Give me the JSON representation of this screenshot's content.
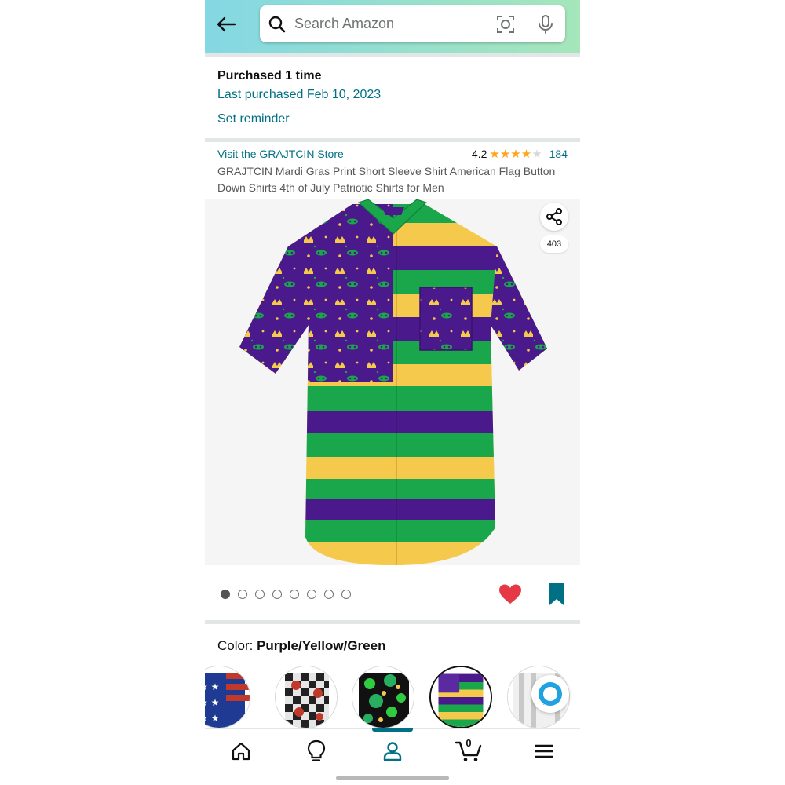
{
  "header": {
    "search_placeholder": "Search Amazon"
  },
  "purchase": {
    "count_text": "Purchased 1 time",
    "last_purchased": "Last purchased Feb 10, 2023",
    "set_reminder": "Set reminder"
  },
  "product": {
    "store_link": "Visit the GRAJTCIN Store",
    "rating": "4.2",
    "rating_stars": 4.2,
    "review_count": "184",
    "title": "GRAJTCIN Mardi Gras Print Short Sleeve Shirt American Flag Button Down Shirts 4th of July Patriotic Shirts for Men",
    "share_count": "403",
    "image_count": 8,
    "active_image_index": 0
  },
  "color": {
    "label": "Color: ",
    "value": "Purple/Yellow/Green",
    "swatches": [
      "american-flag",
      "checkered-roses",
      "shamrock",
      "mardi-gras",
      "white-stripes"
    ],
    "selected_swatch": "mardi-gras"
  },
  "bottom_nav": {
    "items": [
      "home-icon",
      "lightbulb-icon",
      "user-icon",
      "cart-icon",
      "menu-icon"
    ],
    "active": "user-icon",
    "cart_count": "0"
  },
  "colors": {
    "link": "#007185",
    "star": "#ffa41c",
    "heart": "#e63946",
    "bookmark": "#007185",
    "purple": "#4a1a8c",
    "green": "#1aa64a",
    "yellow": "#f5c94c"
  }
}
